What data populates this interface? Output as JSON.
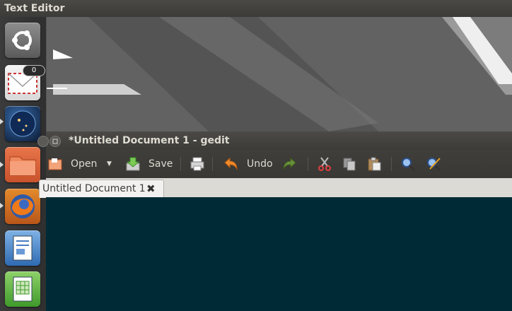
{
  "top_panel": {
    "title": "Text Editor"
  },
  "launcher": {
    "items": [
      {
        "name": "dash-home",
        "icon": "ubuntu-logo-icon"
      },
      {
        "name": "mail",
        "icon": "envelope-icon",
        "badge": "0"
      },
      {
        "name": "browser-globe",
        "icon": "globe-icon"
      },
      {
        "name": "files",
        "icon": "folder-icon"
      },
      {
        "name": "firefox",
        "icon": "firefox-icon"
      },
      {
        "name": "writer",
        "icon": "document-icon"
      },
      {
        "name": "calc",
        "icon": "spreadsheet-icon"
      }
    ]
  },
  "window": {
    "title": "*Untitled Document 1 - gedit",
    "toolbar": {
      "open_label": "Open",
      "save_label": "Save",
      "undo_label": "Undo"
    },
    "tabs": [
      {
        "label": "Untitled Document 1",
        "close": "✖"
      }
    ],
    "editor_bg": "#002b36"
  }
}
